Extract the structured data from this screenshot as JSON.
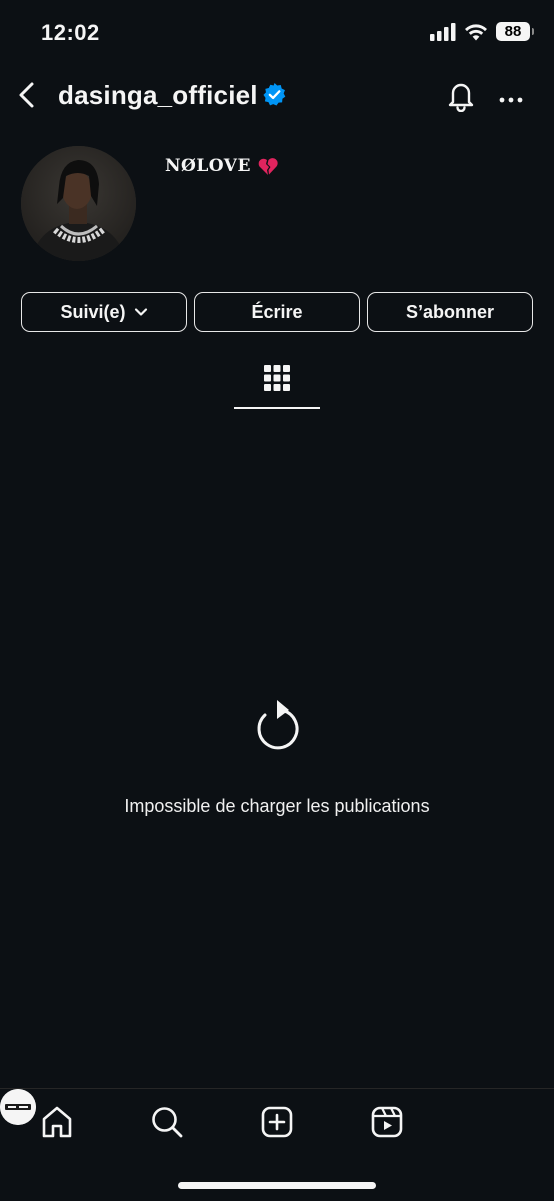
{
  "status_bar": {
    "time": "12:02",
    "battery": "88"
  },
  "header": {
    "username": "dasinga_officiel"
  },
  "profile": {
    "bio": "NØLOVE"
  },
  "actions": {
    "following_label": "Suivi(e)",
    "message_label": "Écrire",
    "subscribe_label": "S’abonner"
  },
  "content": {
    "error_message": "Impossible de charger les publications"
  },
  "colors": {
    "background": "#0c1014",
    "verified": "#0095f6",
    "text": "#f5f5f5",
    "heart": "#e0245e"
  },
  "icons": {
    "header": [
      "back-icon",
      "verified-badge-icon",
      "bell-icon",
      "more-icon"
    ],
    "tabs": [
      "grid-icon"
    ],
    "content": [
      "reload-icon"
    ],
    "bottom_nav": [
      "home-icon",
      "search-icon",
      "create-icon",
      "reels-icon",
      "profile-icon"
    ]
  }
}
